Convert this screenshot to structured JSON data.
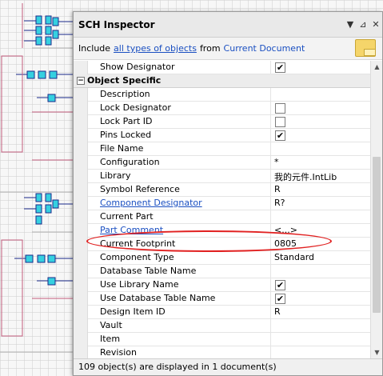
{
  "panel": {
    "title": "SCH Inspector",
    "pin_icon": "dropdown-arrow-icon",
    "close_icon": "close-icon"
  },
  "scope": {
    "prefix": "Include",
    "filter_link": "all types of objects",
    "middle": "from",
    "source_link": "Current Document"
  },
  "rows": {
    "show_designator": {
      "label": "Show Designator",
      "checked": true
    },
    "section_title": "Object Specific",
    "description": {
      "label": "Description",
      "value": ""
    },
    "lock_designator": {
      "label": "Lock Designator",
      "checked": false
    },
    "lock_part_id": {
      "label": "Lock Part ID",
      "checked": false
    },
    "pins_locked": {
      "label": "Pins Locked",
      "checked": true
    },
    "file_name": {
      "label": "File Name",
      "value": ""
    },
    "configuration": {
      "label": "Configuration",
      "value": "*"
    },
    "library": {
      "label": "Library",
      "value": "我的元件.IntLib"
    },
    "symbol_reference": {
      "label": "Symbol Reference",
      "value": "R"
    },
    "component_designator": {
      "label": "Component Designator",
      "value": "R?"
    },
    "current_part": {
      "label": "Current Part",
      "value": ""
    },
    "part_comment": {
      "label": "Part Comment",
      "value": "<...>"
    },
    "current_footprint": {
      "label": "Current Footprint",
      "value": "0805"
    },
    "component_type": {
      "label": "Component Type",
      "value": "Standard"
    },
    "database_table_name": {
      "label": "Database Table Name",
      "value": ""
    },
    "use_library_name": {
      "label": "Use Library Name",
      "checked": true
    },
    "use_database_table_name": {
      "label": "Use Database Table Name",
      "checked": true
    },
    "design_item_id": {
      "label": "Design Item ID",
      "value": "R"
    },
    "vault": {
      "label": "Vault",
      "value": ""
    },
    "item": {
      "label": "Item",
      "value": ""
    },
    "revision": {
      "label": "Revision",
      "value": ""
    }
  },
  "status": "109 object(s) are displayed in 1 document(s)",
  "check_mark": "✔",
  "colors": {
    "link": "#1a4fc1",
    "highlight": "#e12121",
    "part_body": "#35d0e0"
  }
}
